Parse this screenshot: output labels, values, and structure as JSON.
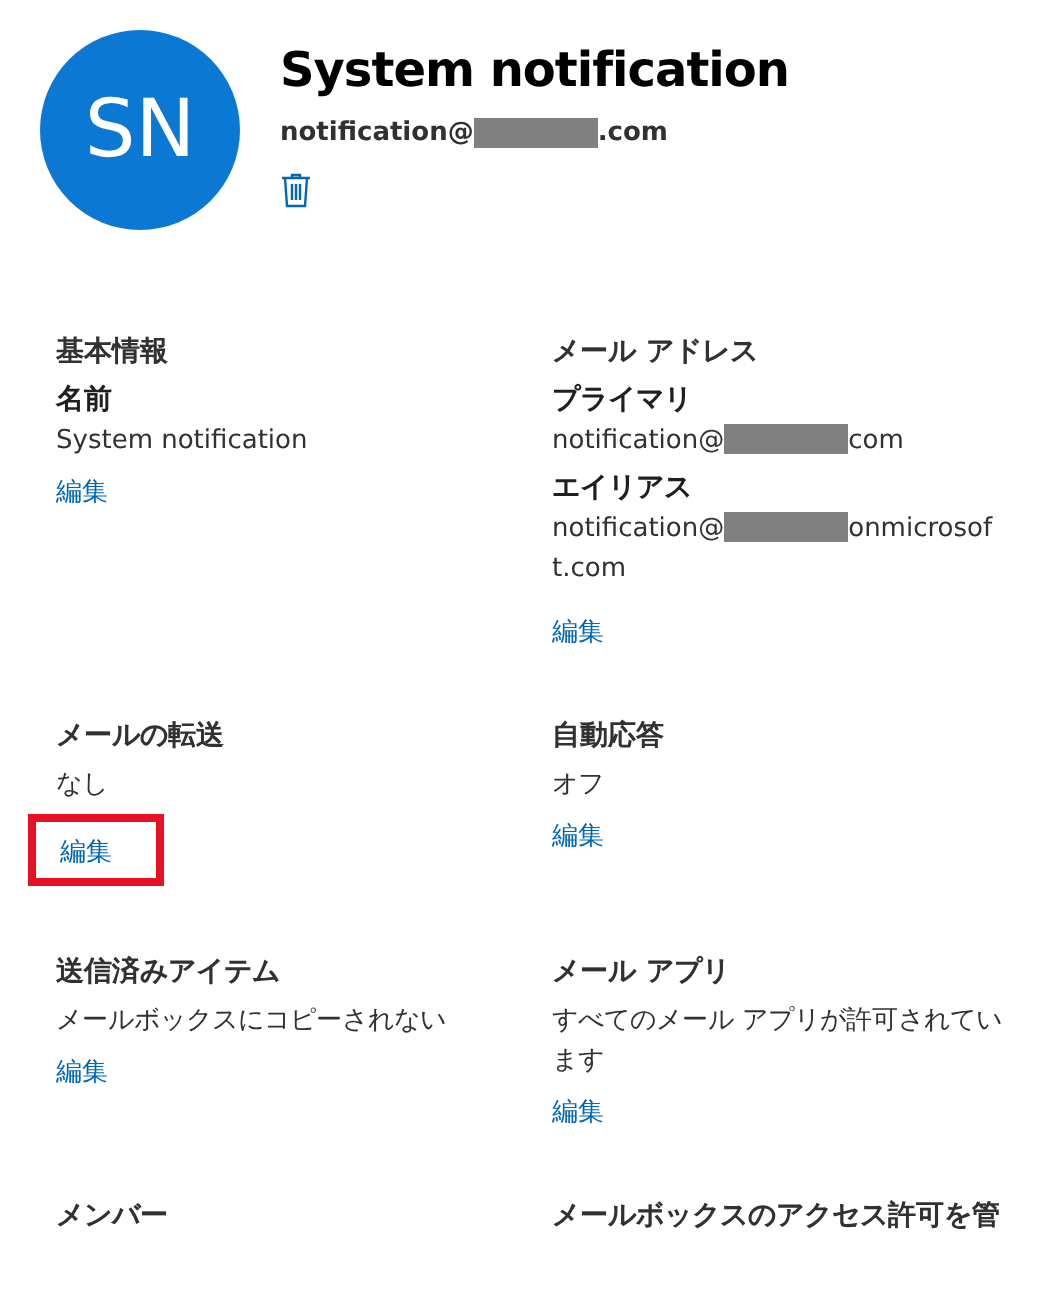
{
  "profile": {
    "initials": "SN",
    "name": "System notification",
    "email": {
      "prefix": "notification@",
      "suffix": ".com"
    }
  },
  "sections": [
    {
      "heading": "基本情報",
      "fields": [
        {
          "label": "名前",
          "kind": "text",
          "value": "System notification"
        }
      ],
      "edit": {
        "label": "編集",
        "highlighted": false
      }
    },
    {
      "heading": "メール アドレス",
      "fields": [
        {
          "label": "プライマリ",
          "kind": "email",
          "prefix": "notification@",
          "suffix": "com"
        },
        {
          "label": "エイリアス",
          "kind": "email",
          "prefix": "notification@",
          "suffix": "onmicrosoft.com"
        }
      ],
      "edit": {
        "label": "編集",
        "highlighted": false
      }
    },
    {
      "heading": "メールの転送",
      "fields": [
        {
          "kind": "text",
          "value": "なし"
        }
      ],
      "edit": {
        "label": "編集",
        "highlighted": true
      }
    },
    {
      "heading": "自動応答",
      "fields": [
        {
          "kind": "text",
          "value": "オフ"
        }
      ],
      "edit": {
        "label": "編集",
        "highlighted": false
      }
    },
    {
      "heading": "送信済みアイテム",
      "fields": [
        {
          "kind": "text",
          "value": "メールボックスにコピーされない"
        }
      ],
      "edit": {
        "label": "編集",
        "highlighted": false
      }
    },
    {
      "heading": "メール アプリ",
      "fields": [
        {
          "kind": "text",
          "value": "すべてのメール アプリが許可されています"
        }
      ],
      "edit": {
        "label": "編集",
        "highlighted": false
      }
    },
    {
      "heading": "メンバー"
    },
    {
      "heading": "メールボックスのアクセス許可を管"
    }
  ]
}
